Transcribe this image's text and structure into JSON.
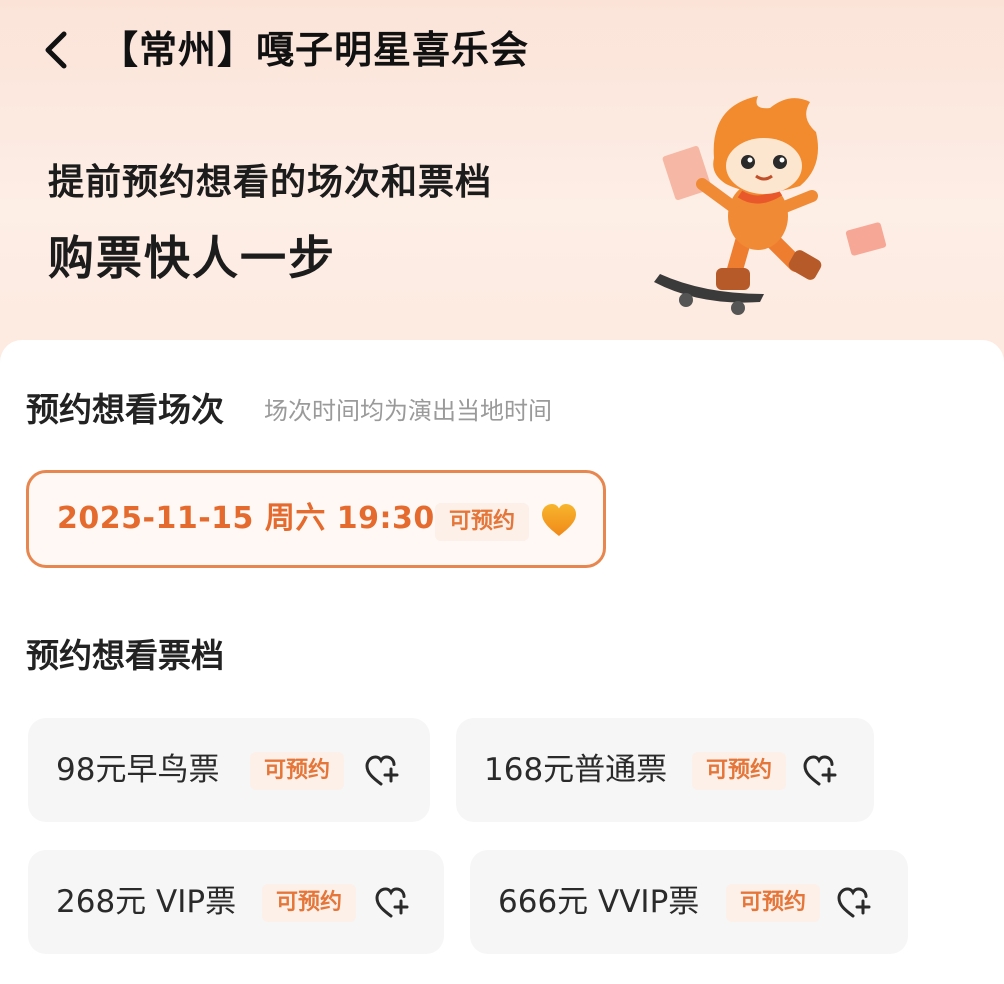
{
  "header": {
    "title": "【常州】嘎子明星喜乐会"
  },
  "hero": {
    "line1": "提前预约想看的场次和票档",
    "line2": "购票快人一步"
  },
  "session_section": {
    "title": "预约想看场次",
    "hint": "场次时间均为演出当地时间",
    "sessions": [
      {
        "label": "2025-11-15 周六 19:30",
        "status": "可预约"
      }
    ]
  },
  "ticket_section": {
    "title": "预约想看票档",
    "tickets": [
      {
        "label": "98元早鸟票",
        "status": "可预约"
      },
      {
        "label": "168元普通票",
        "status": "可预约"
      },
      {
        "label": "268元 VIP票",
        "status": "可预约"
      },
      {
        "label": "666元 VVIP票",
        "status": "可预约"
      }
    ]
  },
  "icons": {
    "back": "chevron-left-icon",
    "session_heart": "heart-filled-icon",
    "ticket_heart": "heart-add-icon"
  },
  "colors": {
    "accent": "#e46a2d",
    "border": "#e7864e",
    "badge_bg": "#fdf0e8",
    "heart": "#f5a21c"
  }
}
